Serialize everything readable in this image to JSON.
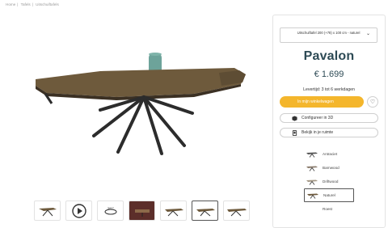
{
  "breadcrumb": [
    "Home",
    "Tafels",
    "Uitschuiftafels"
  ],
  "thumbnails": [
    {
      "name": "table-front"
    },
    {
      "name": "video"
    },
    {
      "name": "360"
    },
    {
      "name": "table-detail"
    },
    {
      "name": "table-top"
    },
    {
      "name": "table-side"
    },
    {
      "name": "table-extended"
    }
  ],
  "product": {
    "variant_selected": "Uitschuiftafel 200 (+78) x 100 cm - naturel",
    "name": "Pavalon",
    "price": "€ 1.699",
    "delivery": "Levertijd: 3 tot 6 werkdagen",
    "cart_label": "In mijn winkelwagen",
    "configure_label": "Configureer in 3D",
    "room_label": "Bekijk in je ruimte"
  },
  "colors": [
    {
      "label": "Antraciet",
      "selected": false
    },
    {
      "label": "Barnwood",
      "selected": false
    },
    {
      "label": "Driftwood",
      "selected": false
    },
    {
      "label": "Naturel",
      "selected": true
    },
    {
      "label": "Roest",
      "selected": false
    }
  ],
  "brand_colors": {
    "accent": "#f4b62c",
    "title": "#2d4a55"
  }
}
